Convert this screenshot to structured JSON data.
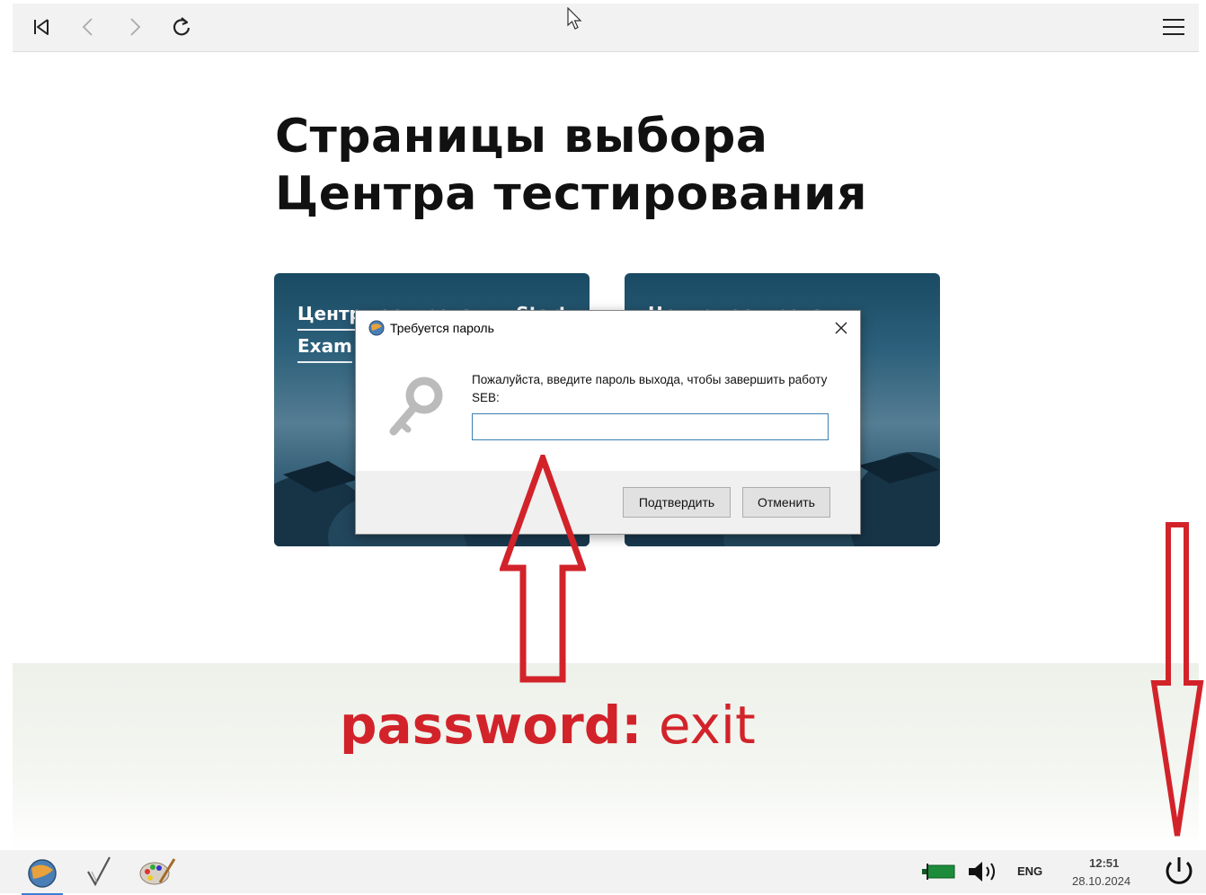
{
  "page": {
    "heading_line1": "Страницы выбора",
    "heading_line2": "Центра тестирования"
  },
  "toolbar": {
    "icons": [
      "first-page-icon",
      "back-icon",
      "forward-icon",
      "reload-icon",
      "menu-icon"
    ]
  },
  "cards": [
    {
      "label_line1": "Центр тестирования Start",
      "label_line2": "Exam"
    },
    {
      "label_line1": "Центр тестирования",
      "label_line2": ""
    }
  ],
  "dialog": {
    "title": "Требуется пароль",
    "message": "Пожалуйста, введите пароль выхода, чтобы завершить работу SEB:",
    "password_value": "",
    "confirm_label": "Подтвердить",
    "cancel_label": "Отменить"
  },
  "annotation": {
    "label": "password:",
    "value": "exit",
    "color": "#d2232a"
  },
  "taskbar": {
    "apps": [
      "seb-icon",
      "check-icon",
      "paint-icon"
    ],
    "language": "ENG",
    "time": "12:51",
    "date": "28.10.2024"
  }
}
